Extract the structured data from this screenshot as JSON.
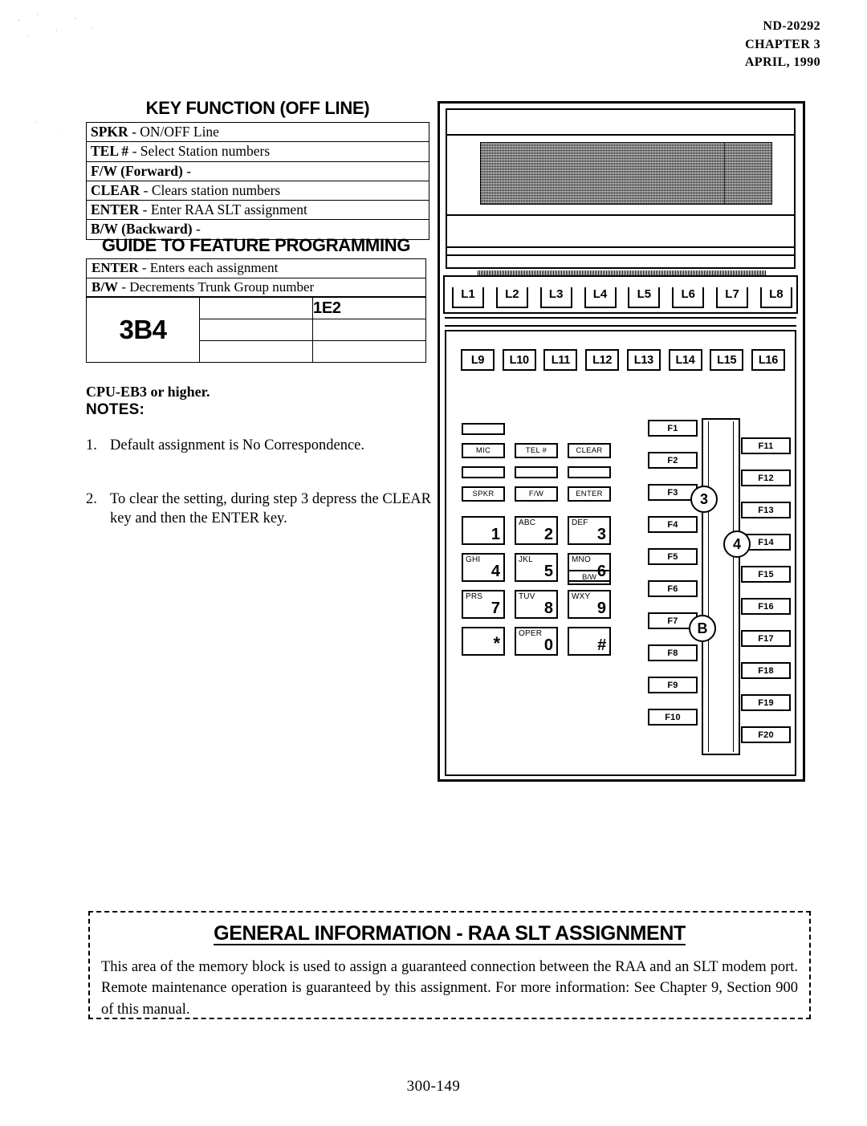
{
  "header": {
    "doc_number": "ND-20292",
    "chapter": "CHAPTER 3",
    "date": "APRIL, 1990"
  },
  "key_function": {
    "title": "KEY FUNCTION (OFF LINE)",
    "rows": [
      {
        "key": "SPKR",
        "sep": "- ",
        "desc": "ON/OFF Line"
      },
      {
        "key": "TEL #",
        "sep": "- ",
        "desc": "Select Station numbers"
      },
      {
        "key": "F/W (Forward)",
        "sep": "- ",
        "desc": ""
      },
      {
        "key": "CLEAR",
        "sep": "- ",
        "desc": "Clears station numbers"
      },
      {
        "key": "ENTER",
        "sep": "- ",
        "desc": "Enter RAA SLT assignment"
      },
      {
        "key": "B/W (Backward)",
        "sep": "- ",
        "desc": ""
      }
    ]
  },
  "guide": {
    "title": "GUIDE TO FEATURE PROGRAMMING",
    "rows": [
      {
        "key": "ENTER",
        "sep": "- ",
        "desc": "Enters each assignment"
      },
      {
        "key": "B/W",
        "sep": "- ",
        "desc": "Decrements Trunk Group number"
      }
    ]
  },
  "address_grid": {
    "main": "3B4",
    "cells": [
      {
        "middle": "",
        "right": "1E2"
      },
      {
        "middle": "",
        "right": ""
      },
      {
        "middle": "",
        "right": ""
      }
    ]
  },
  "notes": {
    "cpu_requirement": "CPU-EB3 or higher.",
    "label": "NOTES:",
    "items": [
      {
        "num": "1.",
        "text": "Default assignment is No Correspondence."
      },
      {
        "num": "2.",
        "text": "To clear the setting, during step 3 depress the CLEAR key and then the ENTER key."
      }
    ]
  },
  "phone": {
    "line_keys_top": [
      "L1",
      "L2",
      "L3",
      "L4",
      "L5",
      "L6",
      "L7",
      "L8"
    ],
    "line_keys_bottom": [
      "L9",
      "L10",
      "L11",
      "L12",
      "L13",
      "L14",
      "L15",
      "L16"
    ],
    "feature_keys": [
      "MIC",
      "TEL #",
      "CLEAR",
      "SPKR",
      "F/W",
      "ENTER"
    ],
    "dial_keys": [
      {
        "letters": "",
        "digit": "1"
      },
      {
        "letters": "ABC",
        "digit": "2"
      },
      {
        "letters": "DEF",
        "digit": "3"
      },
      {
        "letters": "GHI",
        "digit": "4"
      },
      {
        "letters": "JKL",
        "digit": "5"
      },
      {
        "letters": "MNO",
        "digit": "6"
      },
      {
        "letters": "PRS",
        "digit": "7"
      },
      {
        "letters": "TUV",
        "digit": "8"
      },
      {
        "letters": "WXY",
        "digit": "9"
      },
      {
        "letters": "",
        "digit": "*"
      },
      {
        "letters": "OPER",
        "digit": "0"
      },
      {
        "letters": "",
        "digit": "#"
      }
    ],
    "bw_key": "B/W",
    "function_keys_left": [
      "F1",
      "F2",
      "F3",
      "F4",
      "F5",
      "F6",
      "F7",
      "F8",
      "F9",
      "F10"
    ],
    "function_keys_right": [
      "F11",
      "F12",
      "F13",
      "F14",
      "F15",
      "F16",
      "F17",
      "F18",
      "F19",
      "F20"
    ],
    "callouts": [
      "3",
      "4",
      "B"
    ]
  },
  "general_information": {
    "title": "GENERAL INFORMATION  -  RAA SLT ASSIGNMENT",
    "body": "This area of the memory block is used to assign a guaranteed connection between the RAA and an SLT modem port.  Remote maintenance operation is guaranteed by this assignment.  For more information:  See Chapter 9, Section 900 of this manual."
  },
  "footer": {
    "page_number": "300-149"
  }
}
